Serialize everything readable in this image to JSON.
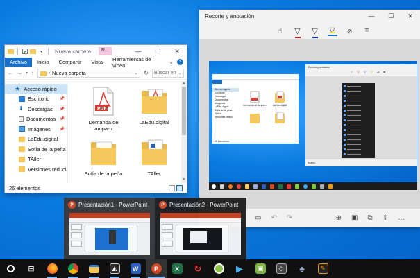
{
  "explorer": {
    "title": "Nueva carpeta",
    "contextual_tab": "R...",
    "ribbon_tabs": [
      "Archivo",
      "Inicio",
      "Compartir",
      "Vista",
      "Herramientas de vídeo"
    ],
    "address": "Nueva carpeta",
    "search_placeholder": "Buscar en ...",
    "nav_items": [
      {
        "label": "Acceso rápido",
        "icon": "star-icon",
        "selected": true
      },
      {
        "label": "Escritorio",
        "icon": "desktop-icon",
        "pinned": true
      },
      {
        "label": "Descargas",
        "icon": "download-icon",
        "pinned": true
      },
      {
        "label": "Documentos",
        "icon": "documents-icon",
        "pinned": true
      },
      {
        "label": "Imágenes",
        "icon": "pictures-icon",
        "pinned": true
      },
      {
        "label": "LaEdu.digital",
        "icon": "folder-icon"
      },
      {
        "label": "Sofía de la peña",
        "icon": "folder-icon"
      },
      {
        "label": "TAller",
        "icon": "folder-icon"
      },
      {
        "label": "Versiones reduci",
        "icon": "folder-icon"
      }
    ],
    "files": [
      {
        "label": "Demanda de amparo",
        "type": "pdf"
      },
      {
        "label": "LaEdu.digital",
        "type": "folder-pdf"
      },
      {
        "label": "Sofía de la peña",
        "type": "folder"
      },
      {
        "label": "TAller",
        "type": "folder-doc"
      }
    ],
    "status": "26 elementos"
  },
  "snip": {
    "title": "Recorte y anotación",
    "tools": [
      "touch-writing-icon",
      "ballpoint-pen-icon",
      "pencil-icon",
      "highlighter-icon",
      "eraser-icon",
      "crop-icon"
    ],
    "mini": {
      "explorer_nav": [
        "Acceso rápido",
        "Escritorio",
        "Descargas",
        "Documentos",
        "Imágenes",
        "LaEdu.digital",
        "Sofía de la peña",
        "TAller",
        "Versiones reduci"
      ],
      "explorer_files": [
        "Demanda de amparo",
        "LaEdu.digital"
      ],
      "explorer_status": "26 elementos",
      "snip_title": "Recorte y anotación",
      "snip_bottom": "Nuevo"
    }
  },
  "thumbnails": [
    {
      "title": "Presentación1 - PowerPoint"
    },
    {
      "title": "Presentación2 - PowerPoint"
    }
  ],
  "taskbar": {
    "apps": [
      "cortana",
      "task-view",
      "firefox",
      "chrome",
      "file-explorer",
      "photos",
      "word",
      "powerpoint",
      "excel",
      "app-red",
      "app-green",
      "media-player",
      "app-android",
      "app-tool",
      "app-game",
      "app-paint"
    ]
  },
  "colors": {
    "accent": "#1a6fc7",
    "powerpoint": "#d24726",
    "folder": "#f6c75a"
  }
}
